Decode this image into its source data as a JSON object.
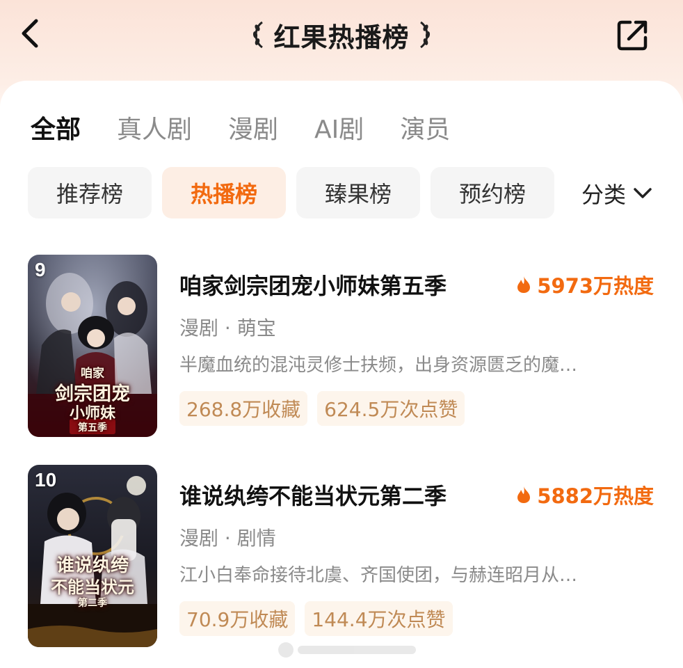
{
  "header": {
    "title": "红果热播榜",
    "back_icon": "chevron-left-icon",
    "share_icon": "share-icon"
  },
  "main_tabs": [
    {
      "label": "全部",
      "active": true
    },
    {
      "label": "真人剧",
      "active": false
    },
    {
      "label": "漫剧",
      "active": false
    },
    {
      "label": "AI剧",
      "active": false
    },
    {
      "label": "演员",
      "active": false
    }
  ],
  "sub_tabs": [
    {
      "label": "推荐榜",
      "active": false
    },
    {
      "label": "热播榜",
      "active": true
    },
    {
      "label": "臻果榜",
      "active": false
    },
    {
      "label": "预约榜",
      "active": false
    }
  ],
  "category": {
    "label": "分类",
    "icon": "chevron-down-icon"
  },
  "items": [
    {
      "rank": "9",
      "title": "咱家剑宗团宠小师妹第五季",
      "heat": "5973万热度",
      "tags": "漫剧 · 萌宝",
      "desc": "半魔血统的混沌灵修士扶频，出身资源匮乏的魔…",
      "favorites": "268.8万收藏",
      "likes": "624.5万次点赞",
      "cover_line1": "咱家",
      "cover_line2": "剑宗团宠",
      "cover_line3": "小师妹",
      "cover_line4": "第五季"
    },
    {
      "rank": "10",
      "title": "谁说纨绔不能当状元第二季",
      "heat": "5882万热度",
      "tags": "漫剧 · 剧情",
      "desc": "江小白奉命接待北虞、齐国使团，与赫连昭月从…",
      "favorites": "70.9万收藏",
      "likes": "144.4万次点赞",
      "cover_line1": "谁说纨绔",
      "cover_line2": "不能当状元",
      "cover_line3": "第二季"
    }
  ],
  "colors": {
    "accent": "#f26a10",
    "stat_text": "#c08a55",
    "stat_bg": "#fdf5ec",
    "header_bg": "#fbe3d8"
  }
}
